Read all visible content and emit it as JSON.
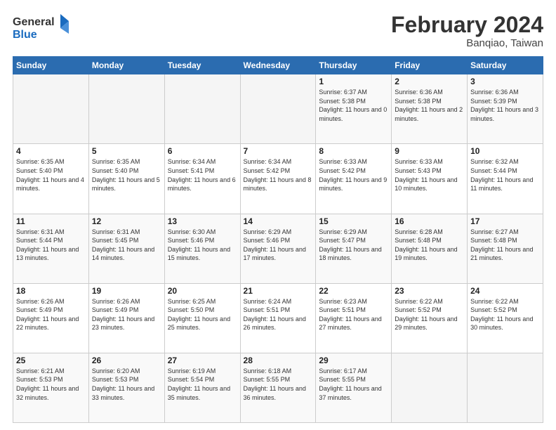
{
  "logo": {
    "line1": "General",
    "line2": "Blue"
  },
  "title": "February 2024",
  "subtitle": "Banqiao, Taiwan",
  "days_header": [
    "Sunday",
    "Monday",
    "Tuesday",
    "Wednesday",
    "Thursday",
    "Friday",
    "Saturday"
  ],
  "weeks": [
    [
      {
        "num": "",
        "info": ""
      },
      {
        "num": "",
        "info": ""
      },
      {
        "num": "",
        "info": ""
      },
      {
        "num": "",
        "info": ""
      },
      {
        "num": "1",
        "info": "Sunrise: 6:37 AM\nSunset: 5:38 PM\nDaylight: 11 hours and 0 minutes."
      },
      {
        "num": "2",
        "info": "Sunrise: 6:36 AM\nSunset: 5:38 PM\nDaylight: 11 hours and 2 minutes."
      },
      {
        "num": "3",
        "info": "Sunrise: 6:36 AM\nSunset: 5:39 PM\nDaylight: 11 hours and 3 minutes."
      }
    ],
    [
      {
        "num": "4",
        "info": "Sunrise: 6:35 AM\nSunset: 5:40 PM\nDaylight: 11 hours and 4 minutes."
      },
      {
        "num": "5",
        "info": "Sunrise: 6:35 AM\nSunset: 5:40 PM\nDaylight: 11 hours and 5 minutes."
      },
      {
        "num": "6",
        "info": "Sunrise: 6:34 AM\nSunset: 5:41 PM\nDaylight: 11 hours and 6 minutes."
      },
      {
        "num": "7",
        "info": "Sunrise: 6:34 AM\nSunset: 5:42 PM\nDaylight: 11 hours and 8 minutes."
      },
      {
        "num": "8",
        "info": "Sunrise: 6:33 AM\nSunset: 5:42 PM\nDaylight: 11 hours and 9 minutes."
      },
      {
        "num": "9",
        "info": "Sunrise: 6:33 AM\nSunset: 5:43 PM\nDaylight: 11 hours and 10 minutes."
      },
      {
        "num": "10",
        "info": "Sunrise: 6:32 AM\nSunset: 5:44 PM\nDaylight: 11 hours and 11 minutes."
      }
    ],
    [
      {
        "num": "11",
        "info": "Sunrise: 6:31 AM\nSunset: 5:44 PM\nDaylight: 11 hours and 13 minutes."
      },
      {
        "num": "12",
        "info": "Sunrise: 6:31 AM\nSunset: 5:45 PM\nDaylight: 11 hours and 14 minutes."
      },
      {
        "num": "13",
        "info": "Sunrise: 6:30 AM\nSunset: 5:46 PM\nDaylight: 11 hours and 15 minutes."
      },
      {
        "num": "14",
        "info": "Sunrise: 6:29 AM\nSunset: 5:46 PM\nDaylight: 11 hours and 17 minutes."
      },
      {
        "num": "15",
        "info": "Sunrise: 6:29 AM\nSunset: 5:47 PM\nDaylight: 11 hours and 18 minutes."
      },
      {
        "num": "16",
        "info": "Sunrise: 6:28 AM\nSunset: 5:48 PM\nDaylight: 11 hours and 19 minutes."
      },
      {
        "num": "17",
        "info": "Sunrise: 6:27 AM\nSunset: 5:48 PM\nDaylight: 11 hours and 21 minutes."
      }
    ],
    [
      {
        "num": "18",
        "info": "Sunrise: 6:26 AM\nSunset: 5:49 PM\nDaylight: 11 hours and 22 minutes."
      },
      {
        "num": "19",
        "info": "Sunrise: 6:26 AM\nSunset: 5:49 PM\nDaylight: 11 hours and 23 minutes."
      },
      {
        "num": "20",
        "info": "Sunrise: 6:25 AM\nSunset: 5:50 PM\nDaylight: 11 hours and 25 minutes."
      },
      {
        "num": "21",
        "info": "Sunrise: 6:24 AM\nSunset: 5:51 PM\nDaylight: 11 hours and 26 minutes."
      },
      {
        "num": "22",
        "info": "Sunrise: 6:23 AM\nSunset: 5:51 PM\nDaylight: 11 hours and 27 minutes."
      },
      {
        "num": "23",
        "info": "Sunrise: 6:22 AM\nSunset: 5:52 PM\nDaylight: 11 hours and 29 minutes."
      },
      {
        "num": "24",
        "info": "Sunrise: 6:22 AM\nSunset: 5:52 PM\nDaylight: 11 hours and 30 minutes."
      }
    ],
    [
      {
        "num": "25",
        "info": "Sunrise: 6:21 AM\nSunset: 5:53 PM\nDaylight: 11 hours and 32 minutes."
      },
      {
        "num": "26",
        "info": "Sunrise: 6:20 AM\nSunset: 5:53 PM\nDaylight: 11 hours and 33 minutes."
      },
      {
        "num": "27",
        "info": "Sunrise: 6:19 AM\nSunset: 5:54 PM\nDaylight: 11 hours and 35 minutes."
      },
      {
        "num": "28",
        "info": "Sunrise: 6:18 AM\nSunset: 5:55 PM\nDaylight: 11 hours and 36 minutes."
      },
      {
        "num": "29",
        "info": "Sunrise: 6:17 AM\nSunset: 5:55 PM\nDaylight: 11 hours and 37 minutes."
      },
      {
        "num": "",
        "info": ""
      },
      {
        "num": "",
        "info": ""
      }
    ]
  ]
}
